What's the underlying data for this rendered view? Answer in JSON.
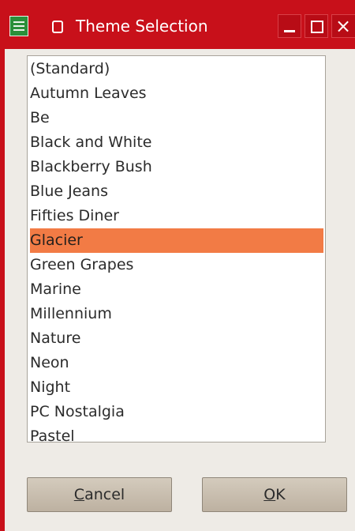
{
  "window": {
    "title": "Theme Selection"
  },
  "themes": [
    "(Standard)",
    "Autumn Leaves",
    "Be",
    "Black and White",
    "Blackberry Bush",
    "Blue Jeans",
    "Fifties Diner",
    "Glacier",
    "Green Grapes",
    "Marine",
    "Millennium",
    "Nature",
    "Neon",
    "Night",
    "PC Nostalgia",
    "Pastel"
  ],
  "selected_theme": "Glacier",
  "buttons": {
    "cancel_first": "C",
    "cancel_rest": "ancel",
    "ok_first": "O",
    "ok_rest": "K"
  },
  "colors": {
    "titlebar": "#c8101a",
    "selection": "#f27b45",
    "dialog": "#eeebe6"
  },
  "icons": {
    "app": "spreadsheet-icon",
    "window_menu": "window-menu-icon",
    "minimize": "minimize-icon",
    "maximize": "maximize-icon",
    "close": "close-icon"
  }
}
